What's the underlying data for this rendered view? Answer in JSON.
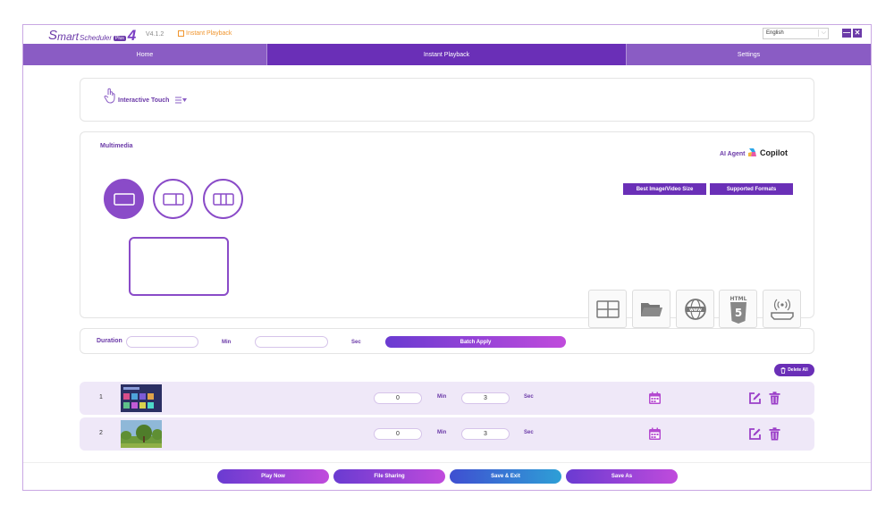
{
  "app": {
    "logo": {
      "s": "S",
      "mart": "mart",
      "scheduler": "Scheduler",
      "badge": "Plus",
      "four": "4"
    },
    "version": "V4.1.2",
    "breadcrumb": "Instant Playback",
    "language": "English",
    "minimize": "—",
    "close": "✕"
  },
  "tabs": [
    {
      "label": "Home",
      "active": false
    },
    {
      "label": "Instant Playback",
      "active": true
    },
    {
      "label": "Settings",
      "active": false
    }
  ],
  "interactive": {
    "label": "Interactive Touch"
  },
  "multimedia": {
    "title": "Multimedia",
    "ai_agent": "AI Agent",
    "copilot": "Copilot",
    "best_size_button": "Best Image/Video Size",
    "formats_button": "Supported Formats",
    "html5_label": "HTML"
  },
  "duration": {
    "label": "Duration",
    "min_value": "",
    "min_label": "Min",
    "sec_value": "",
    "sec_label": "Sec",
    "apply_button": "Batch Apply"
  },
  "delete_all": "Delete All",
  "playlist": [
    {
      "index": "1",
      "min": "0",
      "min_label": "Min",
      "sec": "3",
      "sec_label": "Sec",
      "thumb": "screen-thumbnail"
    },
    {
      "index": "2",
      "min": "0",
      "min_label": "Min",
      "sec": "3",
      "sec_label": "Sec",
      "thumb": "landscape-thumbnail"
    }
  ],
  "bottom": {
    "play_now": "Play Now",
    "file_sharing": "File Sharing",
    "save_exit": "Save & Exit",
    "save_as": "Save As"
  },
  "colors": {
    "accent": "#6a2fb7",
    "tab": "#8a5cc4",
    "highlight": "#f0952e",
    "row": "#efe8f8"
  }
}
